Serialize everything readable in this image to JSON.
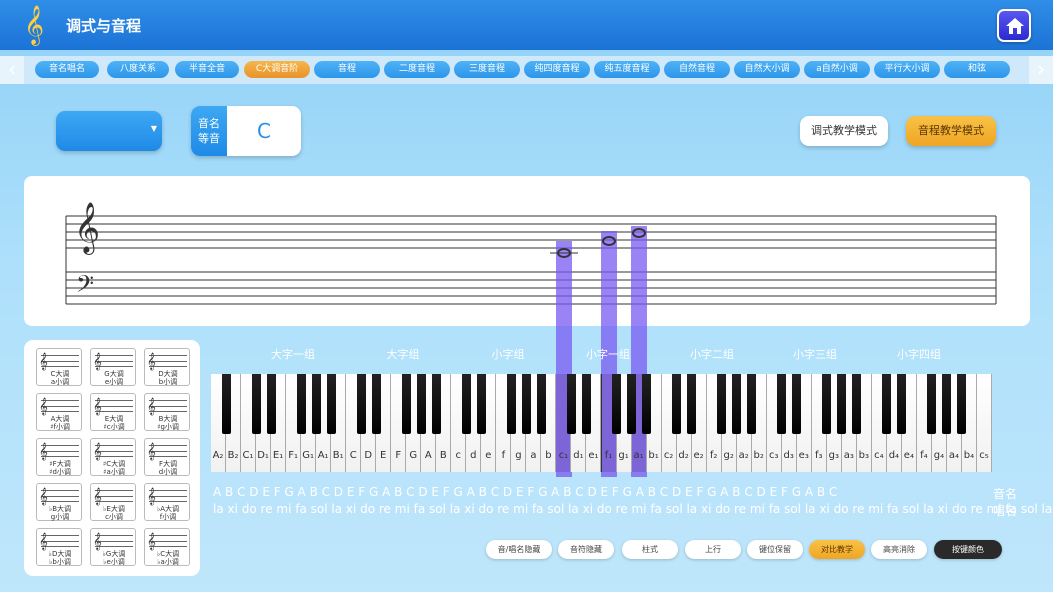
{
  "header": {
    "title": "调式与音程",
    "home_icon": "home-icon",
    "logo_icon": "treble-clef-icon"
  },
  "tabs": [
    "音名唱名",
    "八度关系",
    "半音全音",
    "C大调音阶",
    "音程",
    "二度音程",
    "三度音程",
    "纯四度音程",
    "纯五度音程",
    "自然音程",
    "自然大小调",
    "a自然小调",
    "平行大小调",
    "和弦"
  ],
  "active_tab": "C大调音阶",
  "accent_color": "#f0a524",
  "primary_color": "#1f8ae6",
  "highlight_color": "#7a5af0",
  "note_box": {
    "label": "音名\n等音",
    "label_line1": "音名",
    "label_line2": "等音",
    "value": "C"
  },
  "mode_buttons": {
    "scale_mode": "调式教学模式",
    "interval_mode": "音程教学模式"
  },
  "staff": {
    "treble_clef": "𝄞",
    "bass_clef": "𝄢",
    "notes": [
      "c1",
      "f1",
      "a1"
    ]
  },
  "key_signatures": [
    {
      "major": "C大调",
      "minor": "a小调"
    },
    {
      "major": "G大调",
      "minor": "e小调"
    },
    {
      "major": "D大调",
      "minor": "b小调"
    },
    {
      "major": "A大调",
      "minor": "♯f小调"
    },
    {
      "major": "E大调",
      "minor": "♯c小调"
    },
    {
      "major": "B大调",
      "minor": "♯g小调"
    },
    {
      "major": "♯F大调",
      "minor": "♯d小调"
    },
    {
      "major": "♯C大调",
      "minor": "♯a小调"
    },
    {
      "major": "F大调",
      "minor": "d小调"
    },
    {
      "major": "♭B大调",
      "minor": "g小调"
    },
    {
      "major": "♭E大调",
      "minor": "c小调"
    },
    {
      "major": "♭A大调",
      "minor": "f小调"
    },
    {
      "major": "♭D大调",
      "minor": "♭b小调"
    },
    {
      "major": "♭G大调",
      "minor": "♭e小调"
    },
    {
      "major": "♭C大调",
      "minor": "♭a小调"
    }
  ],
  "octave_groups": [
    "大字一组",
    "大字组",
    "小字组",
    "小字一组",
    "小字二组",
    "小字三组",
    "小字四组"
  ],
  "white_keys": [
    "A₂",
    "B₂",
    "C₁",
    "D₁",
    "E₁",
    "F₁",
    "G₁",
    "A₁",
    "B₁",
    "C",
    "D",
    "E",
    "F",
    "G",
    "A",
    "B",
    "c",
    "d",
    "e",
    "f",
    "g",
    "a",
    "b",
    "c₁",
    "d₁",
    "e₁",
    "f₁",
    "g₁",
    "a₁",
    "b₁",
    "c₂",
    "d₂",
    "e₂",
    "f₂",
    "g₂",
    "a₂",
    "b₂",
    "c₃",
    "d₃",
    "e₃",
    "f₃",
    "g₃",
    "a₃",
    "b₃",
    "c₄",
    "d₄",
    "e₄",
    "f₄",
    "g₄",
    "a₄",
    "b₄",
    "c₅"
  ],
  "highlighted_keys": [
    "c₁",
    "f₁",
    "a₁"
  ],
  "note_names_row": "A B C D E F G A B C D E F G A B C D E F G A B C D E F G A B C D E F G A B C D E F G A B C D E F G A B C",
  "note_names_label": "音名",
  "solfege_row": "la xi do re mi fa sol la xi do re mi fa sol la xi do re mi fa sol la xi do re mi fa sol la xi do re mi fa sol la xi do re mi fa sol la xi do re mi fa sol la xi do",
  "solfege_label": "唱名",
  "controls": [
    "音/唱名隐藏",
    "音符隐藏",
    "柱式",
    "上行",
    "键位保留",
    "对比教学",
    "高亮消除",
    "按键颜色"
  ],
  "active_control": "对比教学"
}
